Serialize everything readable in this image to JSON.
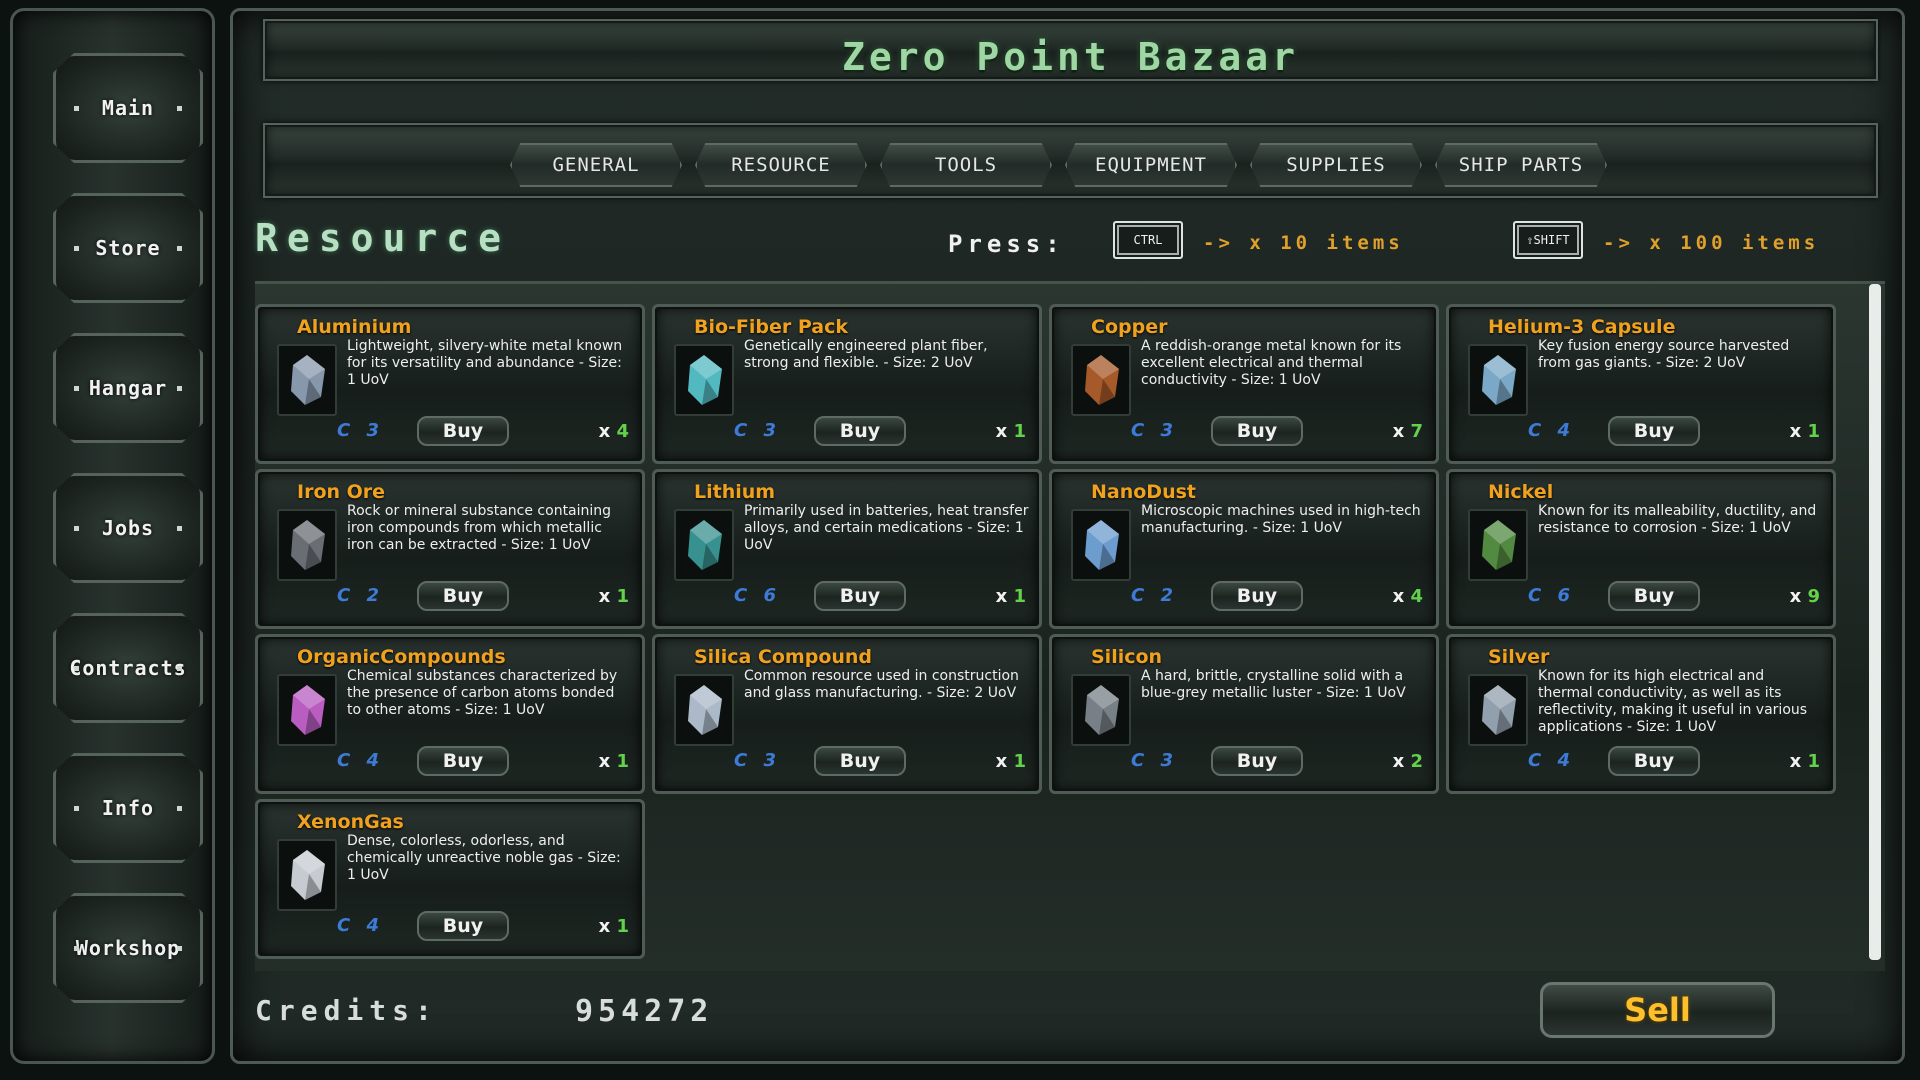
{
  "sidebar": {
    "items": [
      {
        "label": "Main"
      },
      {
        "label": "Store"
      },
      {
        "label": "Hangar"
      },
      {
        "label": "Jobs"
      },
      {
        "label": "Contracts"
      },
      {
        "label": "Info"
      },
      {
        "label": "Workshop"
      }
    ]
  },
  "header": {
    "title": "Zero Point Bazaar"
  },
  "tabs": [
    {
      "label": "GENERAL"
    },
    {
      "label": "RESOURCE"
    },
    {
      "label": "TOOLS"
    },
    {
      "label": "EQUIPMENT"
    },
    {
      "label": "SUPPLIES"
    },
    {
      "label": "SHIP PARTS"
    }
  ],
  "section": {
    "title": "Resource"
  },
  "press": {
    "label": "Press:",
    "ctrl_key": "CTRL",
    "ctrl_text": "-> x 10 items",
    "shift_key": "⇧SHIFT",
    "shift_text": "-> x 100 items"
  },
  "items": [
    {
      "name": "Aluminium",
      "desc": "Lightweight, silvery-white metal known for its versatility and abundance - Size: 1 UoV",
      "class": "C 3",
      "buy": "Buy",
      "qty_prefix": "x",
      "qty": "4",
      "icon": "aluminium-icon",
      "color": "#9fb0c8"
    },
    {
      "name": "Bio-Fiber Pack",
      "desc": "Genetically engineered plant fiber, strong and flexible. - Size: 2 UoV",
      "class": "C 3",
      "buy": "Buy",
      "qty_prefix": "x",
      "qty": "1",
      "icon": "bio-fiber-icon",
      "color": "#5fd7e0"
    },
    {
      "name": "Copper",
      "desc": "A reddish-orange metal known for its excellent electrical and thermal conductivity - Size: 1 UoV",
      "class": "C 3",
      "buy": "Buy",
      "qty_prefix": "x",
      "qty": "7",
      "icon": "copper-icon",
      "color": "#c2662e"
    },
    {
      "name": "Helium-3 Capsule",
      "desc": "Key fusion energy source harvested from gas giants. - Size: 2 UoV",
      "class": "C 4",
      "buy": "Buy",
      "qty_prefix": "x",
      "qty": "1",
      "icon": "capsule-icon",
      "color": "#8fc3e6"
    },
    {
      "name": "Iron Ore",
      "desc": "Rock or mineral substance containing iron compounds from which metallic iron can be extracted - Size: 1 UoV",
      "class": "C 2",
      "buy": "Buy",
      "qty_prefix": "x",
      "qty": "1",
      "icon": "iron-ore-icon",
      "color": "#7a7f86"
    },
    {
      "name": "Lithium",
      "desc": "Primarily used in batteries, heat transfer alloys, and certain medications - Size: 1 UoV",
      "class": "C 6",
      "buy": "Buy",
      "qty_prefix": "x",
      "qty": "1",
      "icon": "lithium-icon",
      "color": "#3fa8a6"
    },
    {
      "name": "NanoDust",
      "desc": "Microscopic machines used in high-tech manufacturing. - Size: 1 UoV",
      "class": "C 2",
      "buy": "Buy",
      "qty_prefix": "x",
      "qty": "4",
      "icon": "vial-icon",
      "color": "#7fb6f0"
    },
    {
      "name": "Nickel",
      "desc": "Known for its malleability, ductility, and resistance to corrosion - Size: 1 UoV",
      "class": "C 6",
      "buy": "Buy",
      "qty_prefix": "x",
      "qty": "9",
      "icon": "nickel-icon",
      "color": "#5fa04a"
    },
    {
      "name": "OrganicCompounds",
      "desc": "Chemical substances characterized by the presence of carbon atoms bonded to other atoms - Size: 1 UoV",
      "class": "C 4",
      "buy": "Buy",
      "qty_prefix": "x",
      "qty": "1",
      "icon": "organic-crystal-icon",
      "color": "#d86be0"
    },
    {
      "name": "Silica Compound",
      "desc": "Common resource used in construction and glass manufacturing. - Size: 2 UoV",
      "class": "C 3",
      "buy": "Buy",
      "qty_prefix": "x",
      "qty": "1",
      "icon": "silica-icon",
      "color": "#c8d7ea"
    },
    {
      "name": "Silicon",
      "desc": "A hard, brittle, crystalline solid with a blue-grey metallic luster - Size: 1 UoV",
      "class": "C 3",
      "buy": "Buy",
      "qty_prefix": "x",
      "qty": "2",
      "icon": "silicon-icon",
      "color": "#8b949c"
    },
    {
      "name": "Silver",
      "desc": "Known for its high electrical and thermal conductivity, as well as its reflectivity, making it useful in various applications - Size: 1 UoV",
      "class": "C 4",
      "buy": "Buy",
      "qty_prefix": "x",
      "qty": "1",
      "icon": "silver-icon",
      "color": "#aab8c8"
    },
    {
      "name": "XenonGas",
      "desc": "Dense, colorless, odorless, and chemically unreactive noble gas - Size: 1 UoV",
      "class": "C 4",
      "buy": "Buy",
      "qty_prefix": "x",
      "qty": "1",
      "icon": "gas-canister-icon",
      "color": "#e8ecf4"
    }
  ],
  "footer": {
    "credits_label": "Credits:",
    "credits_value": "954272",
    "sell_label": "Sell"
  }
}
